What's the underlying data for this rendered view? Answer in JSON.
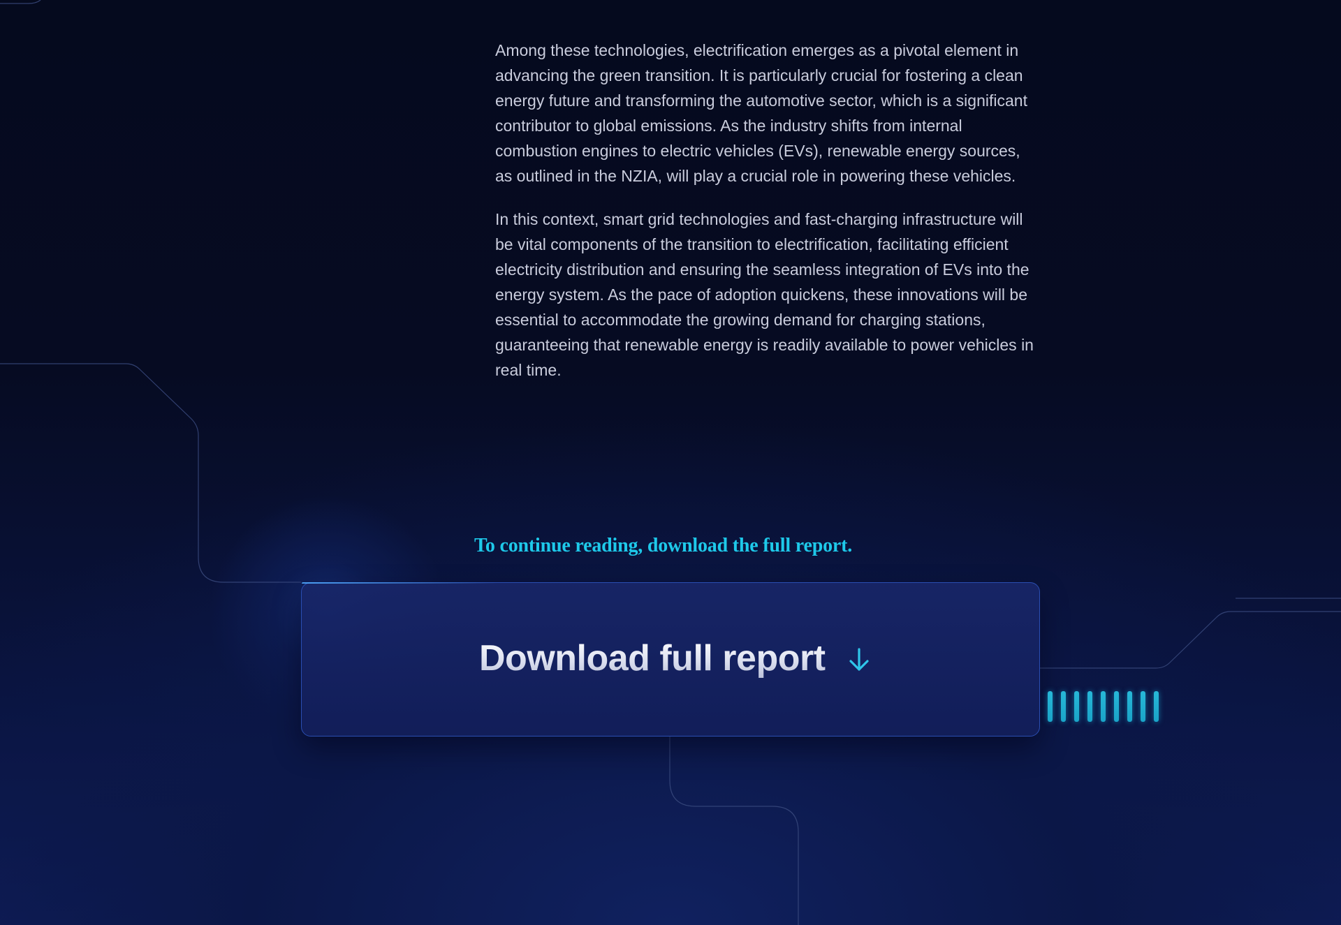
{
  "article": {
    "paragraphs": [
      "Among these technologies, electrification emerges as a pivotal element in advancing the green transition. It is particularly crucial for fostering a clean energy future and transforming the automotive sector, which is a significant contributor to global emissions. As the industry shifts from internal combustion engines to electric vehicles (EVs), renewable energy sources, as outlined in the NZIA, will play a crucial role in powering these vehicles.",
      "In this context, smart grid technologies and fast-charging infrastructure will be vital components of the transition to electrification, facilitating efficient electricity distribution and ensuring the seamless integration of EVs into the energy system. As the pace of adoption quickens, these innovations will be essential to accommodate the growing demand for charging stations, guaranteeing that renewable energy is readily available to power vehicles in real time."
    ]
  },
  "cta": {
    "prompt": "To continue reading, download the full report.",
    "download_label": "Download full report",
    "download_icon": "arrow-down-icon"
  },
  "decor": {
    "indicator_bar_count": 9
  },
  "colors": {
    "accent": "#1ec9ea",
    "background": "#060b22",
    "card": "#16225e",
    "body_text": "#c9ccdc"
  }
}
